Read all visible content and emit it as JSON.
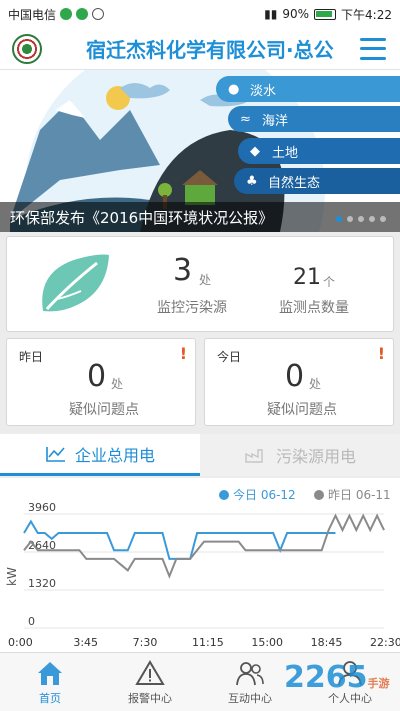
{
  "statusbar": {
    "carrier": "中国电信",
    "battery": "90%",
    "time": "下午4:22"
  },
  "header": {
    "title": "宿迁杰科化学有限公司·总公"
  },
  "banner": {
    "caption": "环保部发布《2016中国环境状况公报》",
    "topics": [
      "淡水",
      "海洋",
      "土地",
      "自然生态"
    ]
  },
  "stats": {
    "sources_value": "3",
    "sources_unit": "处",
    "sources_label": "监控污染源",
    "points_value": "21",
    "points_unit": "个",
    "points_label": "监测点数量"
  },
  "yesterday": {
    "title": "昨日",
    "value": "0",
    "unit": "处",
    "label": "疑似问题点"
  },
  "today": {
    "title": "今日",
    "value": "0",
    "unit": "处",
    "label": "疑似问题点"
  },
  "tabs": {
    "enterprise": "企业总用电",
    "pollution": "污染源用电"
  },
  "chart_data": {
    "type": "line",
    "ylabel": "kW",
    "yticks": [
      "3960",
      "2640",
      "1320",
      "0"
    ],
    "ylim": [
      0,
      3960
    ],
    "xticks": [
      "0:00",
      "3:45",
      "7:30",
      "11:15",
      "15:00",
      "18:45",
      "22:30"
    ],
    "legend_position": "top-right",
    "series": [
      {
        "name": "今日 06-12",
        "color": "#3a9ad9",
        "values": [
          3300,
          3700,
          3300,
          3300,
          3100,
          3300,
          3300,
          3300,
          3300,
          3300,
          3300,
          3300,
          3300,
          2700,
          2700,
          2700,
          3300,
          3300,
          3300,
          3300,
          3300,
          2400,
          2400,
          2400,
          2400,
          3300,
          3300,
          3300,
          3300,
          3300,
          3300,
          3300,
          3300,
          3300,
          3300,
          3300,
          3300,
          2700,
          3300,
          3300,
          3300,
          3300,
          3300,
          3300,
          3300,
          3300
        ]
      },
      {
        "name": "昨日 06-11",
        "color": "#8a8a8a",
        "values": [
          2700,
          3000,
          2700,
          2700,
          2700,
          2700,
          2700,
          2700,
          2700,
          2400,
          2400,
          2400,
          2400,
          2400,
          2200,
          2000,
          2400,
          2400,
          2400,
          2400,
          2400,
          1800,
          2400,
          2400,
          2400,
          2700,
          3000,
          3000,
          3000,
          3000,
          3000,
          3000,
          2700,
          2700,
          2700,
          2700,
          2700,
          2700,
          2700,
          2700,
          2700,
          2700,
          2700,
          2700,
          3400,
          3900,
          3400,
          3900,
          3400,
          3900,
          3400,
          3900,
          3400
        ]
      }
    ]
  },
  "nav": {
    "home": "首页",
    "alarm": "报警中心",
    "interact": "互动中心",
    "personal": "个人中心"
  },
  "watermark": {
    "brand": "2265",
    "sub": "手游网"
  }
}
